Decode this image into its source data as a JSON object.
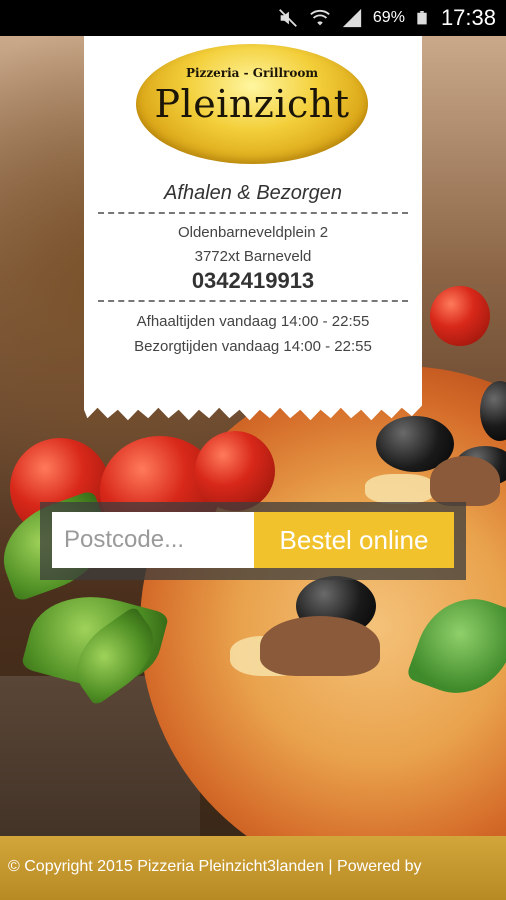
{
  "status_bar": {
    "battery_percent": "69%",
    "time": "17:38",
    "icons": [
      "mute-icon",
      "wifi-icon",
      "signal-icon",
      "battery-icon"
    ]
  },
  "logo": {
    "top_text": "Pizzeria - Grillroom",
    "name": "Pleinzicht"
  },
  "info": {
    "subtitle": "Afhalen & Bezorgen",
    "street": "Oldenbarneveldplein 2",
    "postal_city": "3772xt Barneveld",
    "phone": "0342419913",
    "pickup_hours": "Afhaaltijden vandaag 14:00 - 22:55",
    "delivery_hours": "Bezorgtijden vandaag 14:00 - 22:55"
  },
  "order": {
    "postcode_placeholder": "Postcode...",
    "button_label": "Bestel online"
  },
  "footer": {
    "text": "© Copyright 2015 Pizzeria Pleinzicht3landen | Powered by"
  },
  "colors": {
    "accent": "#f1c22c",
    "footer": "#c49a30"
  }
}
